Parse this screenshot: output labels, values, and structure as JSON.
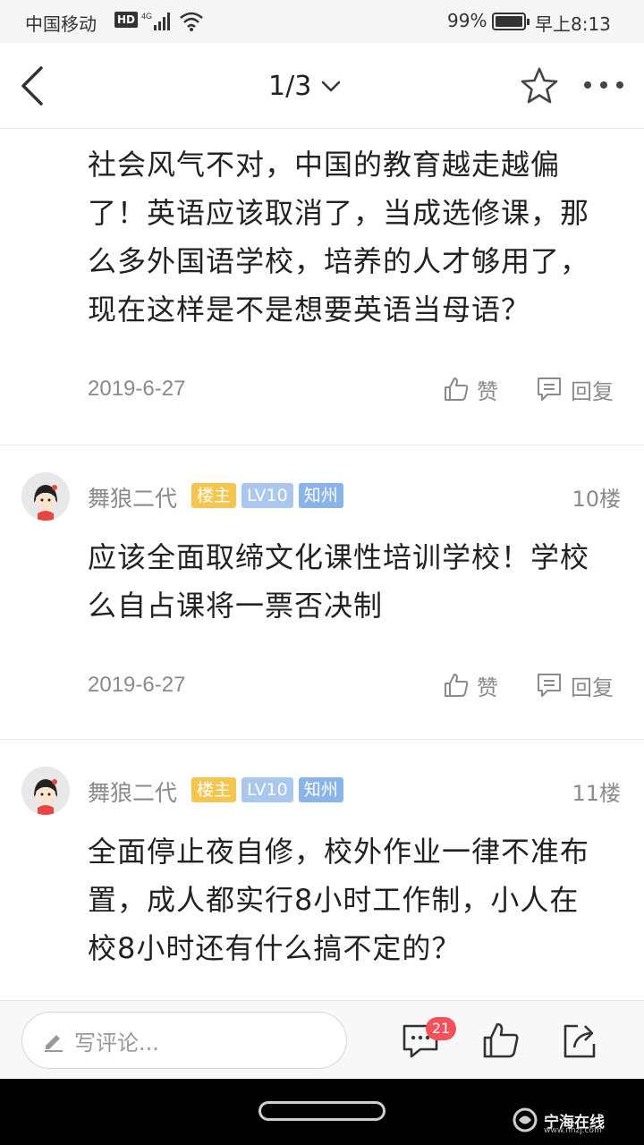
{
  "status_bar": {
    "carrier": "中国移动",
    "hd": "HD",
    "network": "4G",
    "battery_percent": "99%",
    "time": "早上8:13"
  },
  "nav": {
    "pager": "1/3"
  },
  "comments": [
    {
      "text": "社会风气不对，中国的教育越走越偏了！英语应该取消了，当成选修课，那么多外国语学校，培养的人才够用了，现在这样是不是想要英语当母语？",
      "date": "2019-6-27",
      "like_label": "赞",
      "reply_label": "回复"
    },
    {
      "username": "舞狼二代",
      "badge_host": "楼主",
      "badge_level": "LV10",
      "badge_location": "知州",
      "floor": "10楼",
      "text": "应该全面取缔文化课性培训学校！学校么自占课将一票否决制",
      "date": "2019-6-27",
      "like_label": "赞",
      "reply_label": "回复"
    },
    {
      "username": "舞狼二代",
      "badge_host": "楼主",
      "badge_level": "LV10",
      "badge_location": "知州",
      "floor": "11楼",
      "text": "全面停止夜自修，校外作业一律不准布置，成人都实行8小时工作制，小人在校8小时还有什么搞不定的？"
    }
  ],
  "bottom_bar": {
    "comment_placeholder": "写评论...",
    "comment_count": "21"
  },
  "watermark": {
    "name": "宁海在线",
    "url": "www.nhzj.com"
  },
  "icons": {
    "back": "chevron-left-icon",
    "pager_dropdown": "chevron-down-icon",
    "favorite": "star-icon",
    "more": "more-dots-icon",
    "like": "thumbs-up-icon",
    "reply": "reply-bubble-icon",
    "edit": "pencil-icon",
    "comments": "comment-bubble-icon",
    "share": "share-icon"
  },
  "colors": {
    "badge_host": "#f4c64f",
    "badge_level": "#aac8ee",
    "badge_location": "#8ab3ea",
    "count_badge": "#f4515b"
  }
}
